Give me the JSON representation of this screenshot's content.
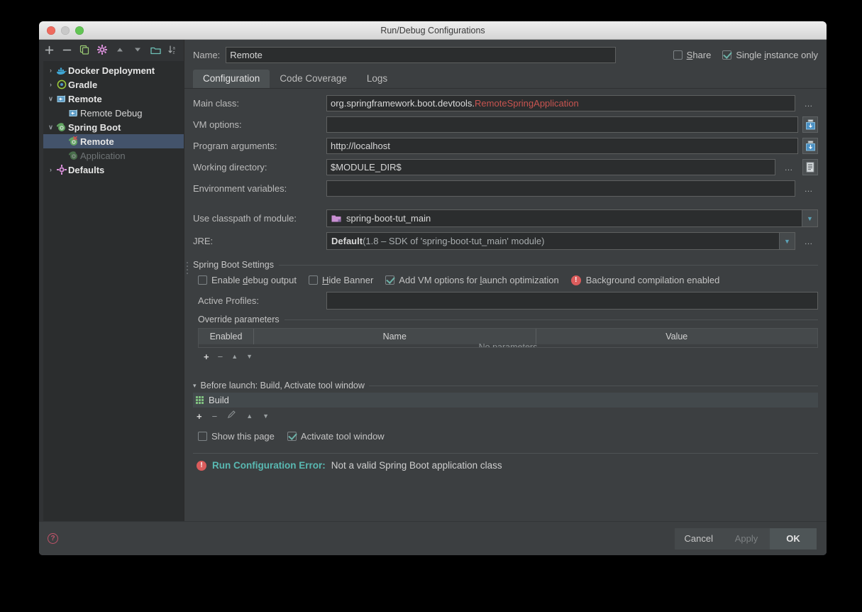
{
  "window": {
    "title": "Run/Debug Configurations",
    "traffic_lights": [
      "close-button",
      "minimize-button",
      "zoom-button"
    ]
  },
  "tree_toolbar": {
    "buttons": [
      {
        "name": "add-configuration-button",
        "glyph": "+"
      },
      {
        "name": "remove-configuration-button",
        "glyph": "−"
      },
      {
        "name": "copy-configuration-button",
        "glyph": "copy-icon"
      },
      {
        "name": "edit-templates-button",
        "glyph": "gear-icon"
      },
      {
        "name": "move-up-button",
        "glyph": "▲"
      },
      {
        "name": "move-down-button",
        "glyph": "▼"
      },
      {
        "name": "new-folder-button",
        "glyph": "folder-icon"
      },
      {
        "name": "sort-configurations-button",
        "glyph": "sort-az-icon"
      }
    ]
  },
  "tree": {
    "nodes": [
      {
        "label": "Docker Deployment",
        "arrow": "›",
        "icon": "docker-icon",
        "depth": 0,
        "bold": true,
        "selected": false,
        "dim": false
      },
      {
        "label": "Gradle",
        "arrow": "›",
        "icon": "gradle-icon",
        "depth": 0,
        "bold": true,
        "selected": false,
        "dim": false
      },
      {
        "label": "Remote",
        "arrow": "∨",
        "icon": "remote-icon",
        "depth": 0,
        "bold": true,
        "selected": false,
        "dim": false
      },
      {
        "label": "Remote Debug",
        "arrow": "",
        "icon": "remote-icon",
        "depth": 1,
        "bold": false,
        "selected": false,
        "dim": false
      },
      {
        "label": "Spring Boot",
        "arrow": "∨",
        "icon": "spring-boot-icon",
        "depth": 0,
        "bold": true,
        "selected": false,
        "dim": false
      },
      {
        "label": "Remote",
        "arrow": "",
        "icon": "spring-boot-error-icon",
        "depth": 1,
        "bold": true,
        "selected": true,
        "dim": false
      },
      {
        "label": "Application",
        "arrow": "",
        "icon": "spring-boot-icon",
        "depth": 1,
        "bold": false,
        "selected": false,
        "dim": true
      },
      {
        "label": "Defaults",
        "arrow": "›",
        "icon": "gear-icon",
        "depth": 0,
        "bold": true,
        "selected": false,
        "dim": false
      }
    ]
  },
  "header": {
    "name_label": "Name:",
    "name_value": "Remote",
    "share_label": "Share",
    "share_label_pre": "S",
    "share_label_post": "hare",
    "share_checked": false,
    "single_instance_pre": "Single ",
    "single_instance_mid": "i",
    "single_instance_post": "nstance only",
    "single_instance_checked": true
  },
  "tabs": [
    {
      "label": "Configuration",
      "active": true
    },
    {
      "label": "Code Coverage",
      "active": false
    },
    {
      "label": "Logs",
      "active": false
    }
  ],
  "form": {
    "main_class_label": "Main class:",
    "main_class_value_prefix": "org.springframework.boot.devtools.",
    "main_class_value_suffix": "RemoteSpringApplication",
    "main_class_browse": "…",
    "vm_options_label": "VM options:",
    "vm_options_value": "",
    "program_args_label": "Program arguments:",
    "program_args_value": "http://localhost",
    "working_dir_label": "Working directory:",
    "working_dir_value": "$MODULE_DIR$",
    "working_dir_browse": "…",
    "env_vars_label": "Environment variables:",
    "env_vars_value": "",
    "env_vars_browse": "…",
    "classpath_label": "Use classpath of module:",
    "classpath_value": "spring-boot-tut_main",
    "jre_label": "JRE:",
    "jre_value_bold": "Default",
    "jre_value_rest": " (1.8 – SDK of 'spring-boot-tut_main' module)",
    "jre_browse": "…"
  },
  "spring_boot_settings": {
    "section_label": "Spring Boot Settings",
    "enable_debug_pre": "Enable ",
    "enable_debug_mid": "d",
    "enable_debug_post": "ebug output",
    "enable_debug_checked": false,
    "hide_banner_pre": "",
    "hide_banner_mid": "H",
    "hide_banner_post": "ide Banner",
    "hide_banner_checked": false,
    "add_vm_pre": "Add VM options for ",
    "add_vm_mid": "l",
    "add_vm_post": "aunch optimization",
    "add_vm_checked": true,
    "background_warning": "Background compilation enabled",
    "active_profiles_label": "Active Profiles:",
    "active_profiles_value": ""
  },
  "override_parameters": {
    "section_label": "Override parameters",
    "columns": [
      "Enabled",
      "Name",
      "Value"
    ],
    "rows": [],
    "empty_message": "No parameters",
    "toolbar": [
      {
        "name": "add-parameter-button",
        "glyph": "+",
        "enabled": true
      },
      {
        "name": "remove-parameter-button",
        "glyph": "−",
        "enabled": false
      },
      {
        "name": "move-parameter-up-button",
        "glyph": "▲",
        "enabled": false
      },
      {
        "name": "move-parameter-down-button",
        "glyph": "▼",
        "enabled": false
      }
    ]
  },
  "before_launch": {
    "header": "Before launch: Build, Activate tool window",
    "collapse_arrow": "▾",
    "tasks": [
      {
        "label": "Build",
        "icon": "build-grid-icon"
      }
    ],
    "toolbar": [
      {
        "name": "add-task-button",
        "glyph": "+",
        "enabled": true
      },
      {
        "name": "remove-task-button",
        "glyph": "−",
        "enabled": false
      },
      {
        "name": "edit-task-button",
        "glyph": "✒",
        "enabled": false
      },
      {
        "name": "move-task-up-button",
        "glyph": "▲",
        "enabled": false
      },
      {
        "name": "move-task-down-button",
        "glyph": "▼",
        "enabled": false
      }
    ],
    "show_page_label": "Show this page",
    "show_page_checked": false,
    "activate_tool_window_label": "Activate tool window",
    "activate_tool_window_checked": true
  },
  "error": {
    "icon": "error-icon",
    "label": "Run Configuration Error:",
    "message": "Not a valid Spring Boot application class"
  },
  "footer": {
    "help_glyph": "?",
    "cancel_label": "Cancel",
    "apply_label": "Apply",
    "ok_label": "OK"
  },
  "colors": {
    "accent_error_red": "#db5c5c",
    "error_label_teal": "#59b9b2",
    "main_class_red": "#c75450",
    "checkbox_check": "#6cb2a8",
    "selection_blue": "#43536b",
    "window_bg": "#3c3f41",
    "panel_bg": "#313335",
    "field_bg": "#2b2d2e"
  }
}
